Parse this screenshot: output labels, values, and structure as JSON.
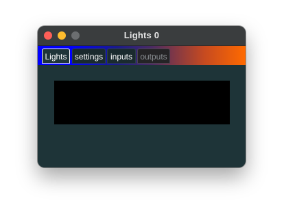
{
  "window": {
    "title": "Lights 0"
  },
  "tabs": [
    {
      "label": "Lights",
      "selected": true
    },
    {
      "label": "settings",
      "selected": false
    },
    {
      "label": "inputs",
      "selected": false
    },
    {
      "label": "outputs",
      "selected": false,
      "disabled": true
    }
  ],
  "colors": {
    "window_background": "#1e3438",
    "display_background": "#000000",
    "tabbar_gradient_start": "#0000ff",
    "tabbar_gradient_end": "#ff6a00",
    "close_button": "#fe5f57",
    "minimize_button": "#febc2e",
    "zoom_button": "#6b6e70"
  },
  "icons": {
    "close": "close-icon",
    "minimize": "minimize-icon",
    "zoom": "zoom-icon"
  }
}
